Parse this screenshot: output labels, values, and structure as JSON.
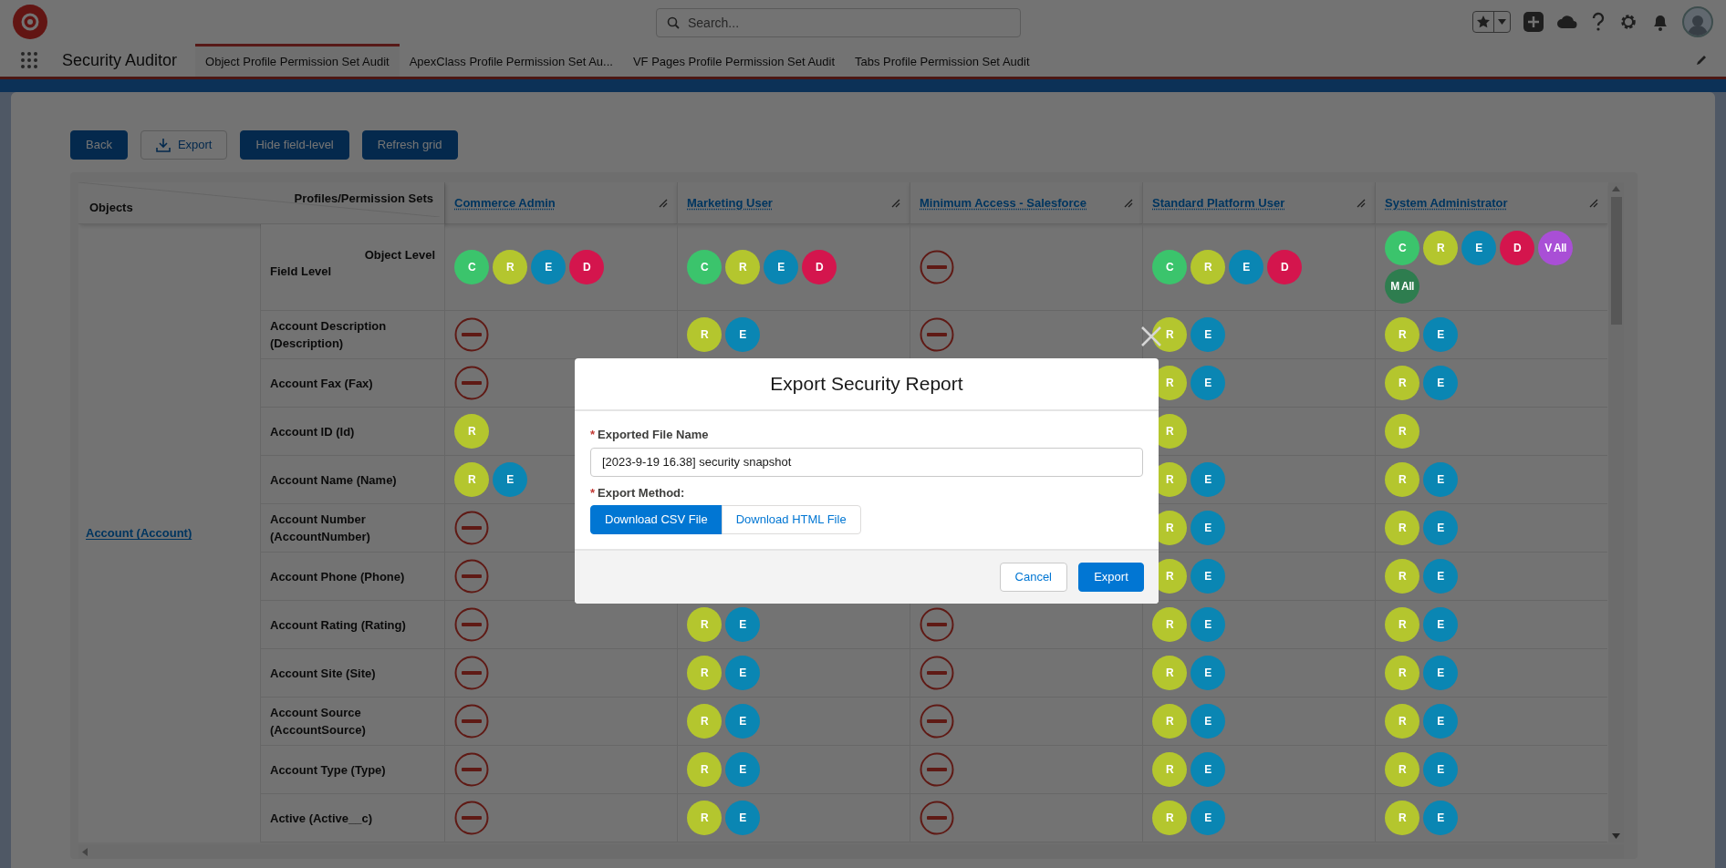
{
  "header": {
    "search": {
      "placeholder": "Search..."
    }
  },
  "nav": {
    "app_name": "Security Auditor",
    "tabs": [
      {
        "label": "Object Profile Permission Set Audit",
        "selected": true
      },
      {
        "label": "ApexClass Profile Permission Set Au...",
        "selected": false
      },
      {
        "label": "VF Pages Profile Permission Set Audit",
        "selected": false
      },
      {
        "label": "Tabs Profile Permission Set Audit",
        "selected": false
      }
    ]
  },
  "toolbar": [
    {
      "label": "Back",
      "kind": "brand"
    },
    {
      "label": "Export",
      "kind": "neutral-icon"
    },
    {
      "label": "Hide field-level",
      "kind": "brand"
    },
    {
      "label": "Refresh grid",
      "kind": "brand"
    }
  ],
  "grid": {
    "corner": {
      "objects": "Objects",
      "profiles": "Profiles/Permission Sets"
    },
    "columns": [
      "Commerce Admin",
      "Marketing User",
      "Minimum Access - Salesforce",
      "Standard Platform User",
      "System Administrator"
    ],
    "object": "Account (Account)",
    "level_row": {
      "object_level": "Object Level",
      "field_level": "Field Level",
      "cells": [
        {
          "kind": "badges",
          "badges": [
            {
              "label": "C",
              "color": "#3bc46c"
            },
            {
              "label": "R",
              "color": "#b4c62e"
            },
            {
              "label": "E",
              "color": "#0a86b3"
            },
            {
              "label": "D",
              "color": "#d4154d"
            }
          ]
        },
        {
          "kind": "badges",
          "badges": [
            {
              "label": "C",
              "color": "#3bc46c"
            },
            {
              "label": "R",
              "color": "#b4c62e"
            },
            {
              "label": "E",
              "color": "#0a86b3"
            },
            {
              "label": "D",
              "color": "#d4154d"
            }
          ]
        },
        {
          "kind": "no-access"
        },
        {
          "kind": "badges",
          "badges": [
            {
              "label": "C",
              "color": "#3bc46c"
            },
            {
              "label": "R",
              "color": "#b4c62e"
            },
            {
              "label": "E",
              "color": "#0a86b3"
            },
            {
              "label": "D",
              "color": "#d4154d"
            }
          ]
        },
        {
          "kind": "badges",
          "badges": [
            {
              "label": "C",
              "color": "#3bc46c"
            },
            {
              "label": "R",
              "color": "#b4c62e"
            },
            {
              "label": "E",
              "color": "#0a86b3"
            },
            {
              "label": "D",
              "color": "#d4154d"
            },
            {
              "label": "V All",
              "color": "#a94fd6"
            },
            {
              "label": "M All",
              "color": "#2e7d4f"
            }
          ]
        }
      ]
    },
    "rows": [
      {
        "field": "Account Description (Description)",
        "cells": [
          {
            "kind": "no-access"
          },
          {
            "kind": "badges",
            "badges": [
              {
                "label": "R",
                "color": "#b4c62e"
              },
              {
                "label": "E",
                "color": "#0a86b3"
              }
            ]
          },
          {
            "kind": "no-access"
          },
          {
            "kind": "badges",
            "badges": [
              {
                "label": "R",
                "color": "#b4c62e"
              },
              {
                "label": "E",
                "color": "#0a86b3"
              }
            ]
          },
          {
            "kind": "badges",
            "badges": [
              {
                "label": "R",
                "color": "#b4c62e"
              },
              {
                "label": "E",
                "color": "#0a86b3"
              }
            ]
          }
        ]
      },
      {
        "field": "Account Fax (Fax)",
        "cells": [
          {
            "kind": "no-access"
          },
          null,
          null,
          {
            "kind": "badges",
            "badges": [
              {
                "label": "R",
                "color": "#b4c62e"
              },
              {
                "label": "E",
                "color": "#0a86b3"
              }
            ]
          },
          {
            "kind": "badges",
            "badges": [
              {
                "label": "R",
                "color": "#b4c62e"
              },
              {
                "label": "E",
                "color": "#0a86b3"
              }
            ]
          }
        ]
      },
      {
        "field": "Account ID (Id)",
        "cells": [
          {
            "kind": "badges",
            "badges": [
              {
                "label": "R",
                "color": "#b4c62e"
              }
            ]
          },
          null,
          null,
          {
            "kind": "badges",
            "badges": [
              {
                "label": "R",
                "color": "#b4c62e"
              }
            ]
          },
          {
            "kind": "badges",
            "badges": [
              {
                "label": "R",
                "color": "#b4c62e"
              }
            ]
          }
        ]
      },
      {
        "field": "Account Name (Name)",
        "cells": [
          {
            "kind": "badges",
            "badges": [
              {
                "label": "R",
                "color": "#b4c62e"
              },
              {
                "label": "E",
                "color": "#0a86b3"
              }
            ]
          },
          null,
          null,
          {
            "kind": "badges",
            "badges": [
              {
                "label": "R",
                "color": "#b4c62e"
              },
              {
                "label": "E",
                "color": "#0a86b3"
              }
            ]
          },
          {
            "kind": "badges",
            "badges": [
              {
                "label": "R",
                "color": "#b4c62e"
              },
              {
                "label": "E",
                "color": "#0a86b3"
              }
            ]
          }
        ]
      },
      {
        "field": "Account Number (AccountNumber)",
        "cells": [
          {
            "kind": "no-access"
          },
          null,
          null,
          {
            "kind": "badges",
            "badges": [
              {
                "label": "R",
                "color": "#b4c62e"
              },
              {
                "label": "E",
                "color": "#0a86b3"
              }
            ]
          },
          {
            "kind": "badges",
            "badges": [
              {
                "label": "R",
                "color": "#b4c62e"
              },
              {
                "label": "E",
                "color": "#0a86b3"
              }
            ]
          }
        ]
      },
      {
        "field": "Account Phone (Phone)",
        "cells": [
          {
            "kind": "no-access"
          },
          null,
          null,
          {
            "kind": "badges",
            "badges": [
              {
                "label": "R",
                "color": "#b4c62e"
              },
              {
                "label": "E",
                "color": "#0a86b3"
              }
            ]
          },
          {
            "kind": "badges",
            "badges": [
              {
                "label": "R",
                "color": "#b4c62e"
              },
              {
                "label": "E",
                "color": "#0a86b3"
              }
            ]
          }
        ]
      },
      {
        "field": "Account Rating (Rating)",
        "cells": [
          {
            "kind": "no-access"
          },
          {
            "kind": "badges",
            "badges": [
              {
                "label": "R",
                "color": "#b4c62e"
              },
              {
                "label": "E",
                "color": "#0a86b3"
              }
            ]
          },
          {
            "kind": "no-access"
          },
          {
            "kind": "badges",
            "badges": [
              {
                "label": "R",
                "color": "#b4c62e"
              },
              {
                "label": "E",
                "color": "#0a86b3"
              }
            ]
          },
          {
            "kind": "badges",
            "badges": [
              {
                "label": "R",
                "color": "#b4c62e"
              },
              {
                "label": "E",
                "color": "#0a86b3"
              }
            ]
          }
        ]
      },
      {
        "field": "Account Site (Site)",
        "cells": [
          {
            "kind": "no-access"
          },
          {
            "kind": "badges",
            "badges": [
              {
                "label": "R",
                "color": "#b4c62e"
              },
              {
                "label": "E",
                "color": "#0a86b3"
              }
            ]
          },
          {
            "kind": "no-access"
          },
          {
            "kind": "badges",
            "badges": [
              {
                "label": "R",
                "color": "#b4c62e"
              },
              {
                "label": "E",
                "color": "#0a86b3"
              }
            ]
          },
          {
            "kind": "badges",
            "badges": [
              {
                "label": "R",
                "color": "#b4c62e"
              },
              {
                "label": "E",
                "color": "#0a86b3"
              }
            ]
          }
        ]
      },
      {
        "field": "Account Source (AccountSource)",
        "cells": [
          {
            "kind": "no-access"
          },
          {
            "kind": "badges",
            "badges": [
              {
                "label": "R",
                "color": "#b4c62e"
              },
              {
                "label": "E",
                "color": "#0a86b3"
              }
            ]
          },
          {
            "kind": "no-access"
          },
          {
            "kind": "badges",
            "badges": [
              {
                "label": "R",
                "color": "#b4c62e"
              },
              {
                "label": "E",
                "color": "#0a86b3"
              }
            ]
          },
          {
            "kind": "badges",
            "badges": [
              {
                "label": "R",
                "color": "#b4c62e"
              },
              {
                "label": "E",
                "color": "#0a86b3"
              }
            ]
          }
        ]
      },
      {
        "field": "Account Type (Type)",
        "cells": [
          {
            "kind": "no-access"
          },
          {
            "kind": "badges",
            "badges": [
              {
                "label": "R",
                "color": "#b4c62e"
              },
              {
                "label": "E",
                "color": "#0a86b3"
              }
            ]
          },
          {
            "kind": "no-access"
          },
          {
            "kind": "badges",
            "badges": [
              {
                "label": "R",
                "color": "#b4c62e"
              },
              {
                "label": "E",
                "color": "#0a86b3"
              }
            ]
          },
          {
            "kind": "badges",
            "badges": [
              {
                "label": "R",
                "color": "#b4c62e"
              },
              {
                "label": "E",
                "color": "#0a86b3"
              }
            ]
          }
        ]
      },
      {
        "field": "Active (Active__c)",
        "cells": [
          {
            "kind": "no-access"
          },
          {
            "kind": "badges",
            "badges": [
              {
                "label": "R",
                "color": "#b4c62e"
              },
              {
                "label": "E",
                "color": "#0a86b3"
              }
            ]
          },
          {
            "kind": "no-access"
          },
          {
            "kind": "badges",
            "badges": [
              {
                "label": "R",
                "color": "#b4c62e"
              },
              {
                "label": "E",
                "color": "#0a86b3"
              }
            ]
          },
          {
            "kind": "badges",
            "badges": [
              {
                "label": "R",
                "color": "#b4c62e"
              },
              {
                "label": "E",
                "color": "#0a86b3"
              }
            ]
          }
        ]
      }
    ]
  },
  "modal": {
    "title": "Export Security Report",
    "file_name": {
      "required": "*",
      "label": "Exported File Name",
      "value": "[2023-9-19 16.38] security snapshot"
    },
    "method": {
      "required": "*",
      "label": "Export Method:",
      "options": [
        {
          "label": "Download CSV File",
          "selected": true
        },
        {
          "label": "Download HTML File",
          "selected": false
        }
      ]
    },
    "buttons": [
      {
        "label": "Cancel",
        "kind": "neutral"
      },
      {
        "label": "Export",
        "kind": "brand"
      }
    ]
  }
}
